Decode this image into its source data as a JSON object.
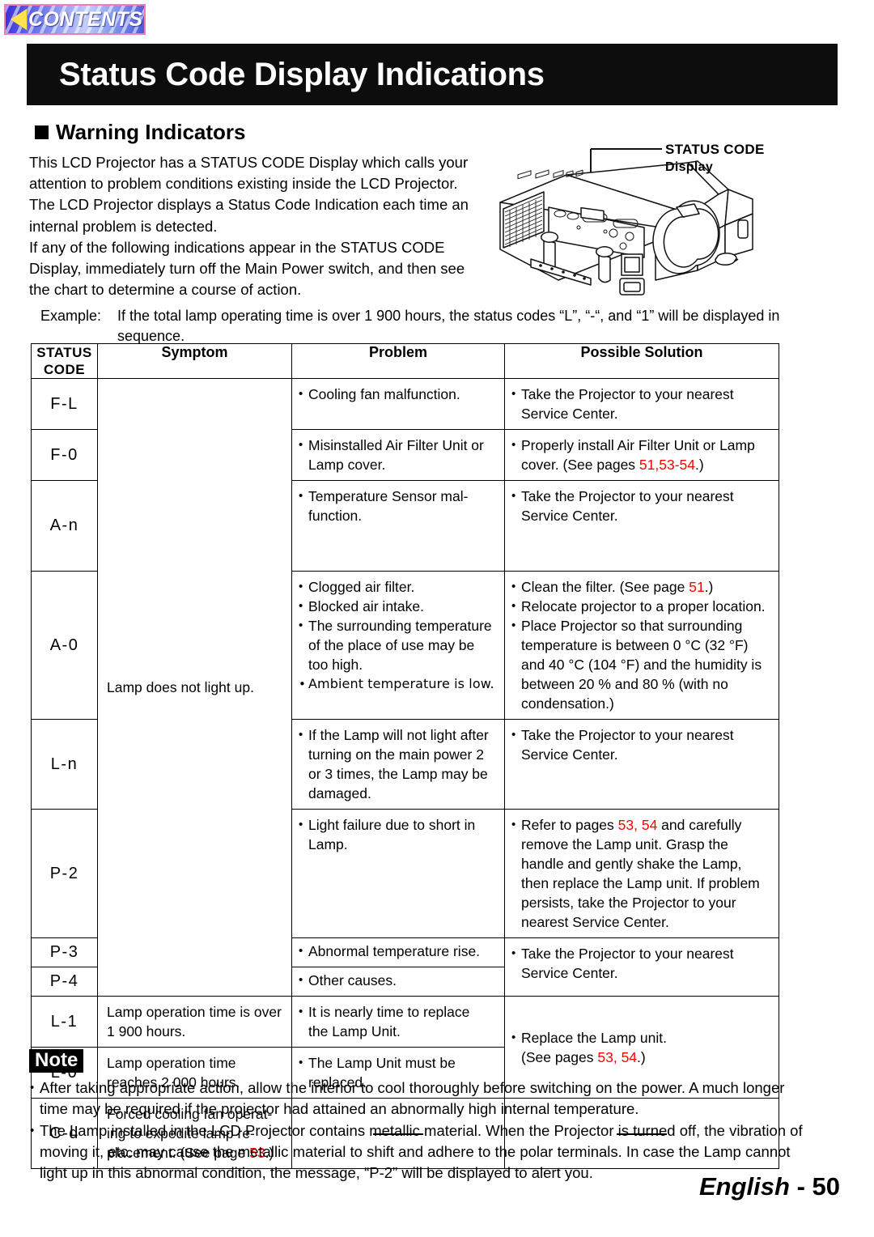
{
  "contents_button": {
    "label": "CONTENTS",
    "icon": "back-triangle-icon"
  },
  "page_title": "Status Code Display Indications",
  "section": {
    "heading": "Warning Indicators"
  },
  "intro": {
    "line1": "This LCD Projector has a STATUS CODE Display which calls your",
    "line2": "attention to problem conditions existing inside the LCD Projector.",
    "line3": "The LCD Projector displays a Status Code Indication each time an",
    "line4": "internal problem is detected.",
    "line5": "If any of the following indications appear in the STATUS CODE",
    "line6": "Display, immediately turn off the Main Power switch, and then see",
    "line7": "the chart to determine a course of action."
  },
  "figure": {
    "callout_line1": "STATUS CODE",
    "callout_line2": "Display",
    "image_name": "lcd-projector-illustration"
  },
  "example": {
    "label": "Example:",
    "line1": "If the total lamp operating time is over 1 900 hours, the status codes “L”, “-“, and “1” will be displayed in",
    "line2": "sequence."
  },
  "table": {
    "headers": {
      "code_line1": "STATUS",
      "code_line2": "CODE",
      "symptom": "Symptom",
      "problem": "Problem",
      "solution": "Possible Solution"
    },
    "symptom_merged": "Lamp does not light up.",
    "rows": [
      {
        "code": "F-L",
        "problem": [
          "Cooling fan malfunction."
        ],
        "solution_line1": "Take the Projector to your nearest",
        "solution_line2": "Service Center."
      },
      {
        "code": "F-0",
        "problem_line1": "Misinstalled Air Filter Unit or",
        "problem_line2": "Lamp cover.",
        "solution_line1": "Properly install Air Filter Unit or Lamp",
        "solution_line2_pre": "cover. (See pages ",
        "solution_pages": "51,53-54",
        "solution_line2_post": ".)"
      },
      {
        "code": "A-n",
        "problem_line1": "Temperature Sensor mal-",
        "problem_line2": "function.",
        "solution_line1": "Take the Projector to your nearest",
        "solution_line2": "Service Center."
      },
      {
        "code": "A-0",
        "problems": [
          "Clogged air filter.",
          "Blocked air intake.",
          "The surrounding temperature of the place of use may be too high.",
          "Ambient temperature is low."
        ],
        "problem3_l1": "The surrounding temperature",
        "problem3_l2": "of the place of use may be",
        "problem3_l3": "too high.",
        "sol1_pre": "Clean the filter. (See page ",
        "sol1_page": "51",
        "sol1_post": ".)",
        "sol2": "Relocate projector to a proper location.",
        "sol3_l1": "Place Projector so that surrounding",
        "sol3_l2": "temperature is between 0 °C (32 °F)",
        "sol3_l3": "and 40 °C (104 °F) and the humidity is",
        "sol3_l4": "between 20 % and 80 % (with no",
        "sol3_l5": "condensation.)"
      },
      {
        "code": "L-n",
        "problem_l1": "If the Lamp will not light after",
        "problem_l2": "turning on the main power 2",
        "problem_l3": "or 3 times, the Lamp may be",
        "problem_l4": "damaged.",
        "solution_line1": "Take the Projector to your nearest",
        "solution_line2": "Service Center."
      },
      {
        "code": "P-2",
        "problem_l1": "Light failure due to short in",
        "problem_l2": "Lamp.",
        "sol_l1_pre": "Refer to pages ",
        "sol_pages": "53, 54",
        "sol_l1_post": " and carefully",
        "sol_l2": "remove the Lamp unit. Grasp the",
        "sol_l3": "handle and gently shake the Lamp,",
        "sol_l4": "then replace the Lamp unit. If problem",
        "sol_l5": "persists, take the Projector to your",
        "sol_l6": "nearest Service Center."
      },
      {
        "code": "P-3",
        "problem": "Abnormal temperature rise.",
        "solution_line1": "Take the Projector to your nearest",
        "solution_line2": "Service Center."
      },
      {
        "code": "P-4",
        "problem": "Other causes."
      },
      {
        "code": "L-1",
        "symptom_l1": "Lamp operation time is over",
        "symptom_l2": "1 900 hours.",
        "problem_l1": "It is nearly time to replace",
        "problem_l2": "the Lamp Unit.",
        "sol_l1": "Replace the Lamp unit.",
        "sol_l2_pre": "(See pages ",
        "sol_pages": "53, 54",
        "sol_l2_post": ".)"
      },
      {
        "code": "L-0",
        "symptom_l1": "Lamp operation time",
        "symptom_l2": "reaches 2 000 hours.",
        "problem_l1": "The Lamp Unit must be",
        "problem_l2": "replaced."
      },
      {
        "code": "C-d",
        "symptom_l1": "Forced cooling fan operat-",
        "symptom_l2": "ing to expedite lamp re-",
        "symptom_l3_pre": "placement. (See page ",
        "symptom_page": "53",
        "symptom_l3_post": ".)",
        "problem": "—",
        "solution": "—"
      }
    ]
  },
  "note": {
    "badge": "Note",
    "items": [
      "After taking appropriate action, allow the interior to cool thoroughly before switching on the power. A much longer time may be required if the projector had attained an abnormally high internal temperature.",
      "The Lamp installed in the LCD Projector contains metallic material. When the Projector is turned off, the vibration of moving it, etc. may cause the metallic material to shift and adhere to the polar terminals. In case the Lamp cannot light up in this abnormal condition, the message, “P-2” will be displayed to alert you."
    ],
    "item1_l1": "After taking appropriate action, allow the interior to cool thoroughly before switching on the power. A much longer",
    "item1_l2": "time may be required if the projector had attained an abnormally high internal temperature.",
    "item2_l1": "The Lamp installed in the LCD Projector contains metallic material. When the Projector is turned off, the vibration",
    "item2_l2": "of moving it, etc. may cause the metallic material to shift and adhere to the polar terminals. In case the Lamp",
    "item2_l3": "cannot light up in this abnormal condition, the message, “P-2” will be displayed to alert you."
  },
  "footer": {
    "language": "English",
    "separator": " - ",
    "page_number": "50"
  },
  "colors": {
    "page_ref": "#ff0000",
    "title_bar": "#0d0d0d",
    "contents_border": "#f57ab8",
    "contents_triangle": "#ffe14d"
  }
}
